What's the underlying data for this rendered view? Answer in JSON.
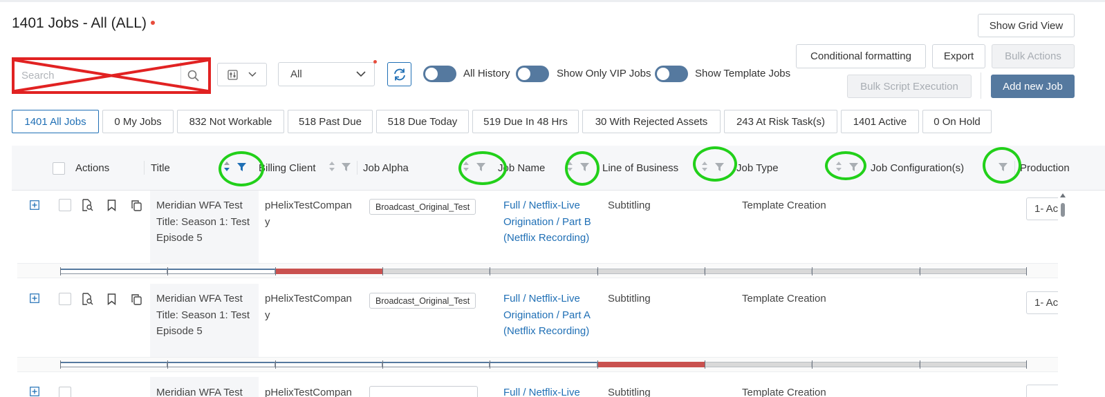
{
  "header": {
    "title": "1401 Jobs - All (ALL)",
    "show_grid_view_label": "Show Grid View"
  },
  "toolbar": {
    "search_placeholder": "Search",
    "filter_value": "All",
    "toggles": [
      {
        "label": "All History",
        "on": false
      },
      {
        "label": "Show Only VIP Jobs",
        "on": false
      },
      {
        "label": "Show Template Jobs",
        "on": false
      }
    ],
    "conditional_formatting_label": "Conditional formatting",
    "export_label": "Export",
    "bulk_actions_label": "Bulk Actions",
    "bulk_script_label": "Bulk Script Execution",
    "add_new_job_label": "Add new Job"
  },
  "tabs": [
    {
      "label": "1401 All Jobs",
      "active": true
    },
    {
      "label": "0 My Jobs",
      "active": false
    },
    {
      "label": "832 Not Workable",
      "active": false
    },
    {
      "label": "518 Past Due",
      "active": false
    },
    {
      "label": "518 Due Today",
      "active": false
    },
    {
      "label": "519 Due In 48 Hrs",
      "active": false
    },
    {
      "label": "30 With Rejected Assets",
      "active": false
    },
    {
      "label": "243 At Risk Task(s)",
      "active": false
    },
    {
      "label": "1401 Active",
      "active": false
    },
    {
      "label": "0 On Hold",
      "active": false
    }
  ],
  "grid": {
    "columns": [
      "Actions",
      "Title",
      "Billing Client",
      "Job Alpha",
      "Job Name",
      "Line of Business",
      "Job Type",
      "Job Configuration(s)",
      "Production"
    ],
    "rows": [
      {
        "title_lines": [
          "Meridian WFA Test",
          "Title: Season 1: Test",
          "Episode 5"
        ],
        "billing_client_lines": [
          "pHelixTestCompan",
          "y"
        ],
        "job_alpha": "Broadcast_Original_Test",
        "job_name_lines": [
          "Full / Netflix-Live",
          "Origination / Part B",
          "(Netflix Recording)"
        ],
        "line_of_business": "Subtitling",
        "job_type": "Template Creation",
        "production": "1- Ac",
        "progress_done_segments": 2,
        "progress_current_segment": 3
      },
      {
        "title_lines": [
          "Meridian WFA Test",
          "Title: Season 1: Test",
          "Episode 5"
        ],
        "billing_client_lines": [
          "pHelixTestCompan",
          "y"
        ],
        "job_alpha": "Broadcast_Original_Test",
        "job_name_lines": [
          "Full / Netflix-Live",
          "Origination / Part A",
          "(Netflix Recording)"
        ],
        "line_of_business": "Subtitling",
        "job_type": "Template Creation",
        "production": "1- Ac",
        "progress_done_segments": 5,
        "progress_current_segment": 6
      },
      {
        "title_lines": [
          "Meridian WFA Test"
        ],
        "billing_client_lines": [
          "pHelixTestCompan"
        ],
        "job_alpha": "",
        "job_name_lines": [
          "Full / Netflix-Live"
        ],
        "line_of_business": "Subtitling",
        "job_type": "Template Creation",
        "production": ""
      }
    ],
    "progress_segment_count": 9
  },
  "colors": {
    "accent": "#1f6fb5",
    "primary_button": "#55799f",
    "annotation_red": "#e12222",
    "annotation_green": "#22d01a",
    "progress_current": "#c9514f",
    "progress_pending": "#d9d9d9"
  }
}
